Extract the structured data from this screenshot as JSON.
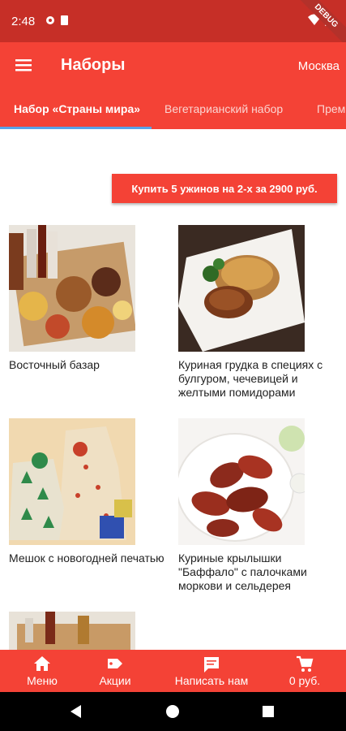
{
  "status_bar": {
    "time": "2:48",
    "debug_badge": "DEBUG"
  },
  "app_bar": {
    "title": "Наборы",
    "city": "Москва"
  },
  "tabs": [
    {
      "label": "Набор «Страны мира»",
      "active": true
    },
    {
      "label": "Вегетарианский набор",
      "active": false
    },
    {
      "label": "Прем",
      "active": false
    }
  ],
  "promo": {
    "label": "Купить 5 ужинов на 2-х за 2900 руб."
  },
  "products": [
    {
      "title": "Восточный базар"
    },
    {
      "title": "Куриная грудка в специях с булгуром, чечевицей и желтыми помидорами"
    },
    {
      "title": "Мешок с новогодней печатью"
    },
    {
      "title": "Куриные крылышки \"Баффало\" с палочками моркови и сельдерея"
    },
    {
      "title": ""
    }
  ],
  "bottom_nav": [
    {
      "label": "Меню",
      "icon": "home-icon"
    },
    {
      "label": "Акции",
      "icon": "tag-icon"
    },
    {
      "label": "Написать нам",
      "icon": "chat-icon"
    },
    {
      "label": "0 руб.",
      "icon": "cart-icon"
    }
  ],
  "colors": {
    "primary": "#f44236",
    "status_bar": "#c62f27",
    "tab_indicator": "#5aa2e8"
  }
}
